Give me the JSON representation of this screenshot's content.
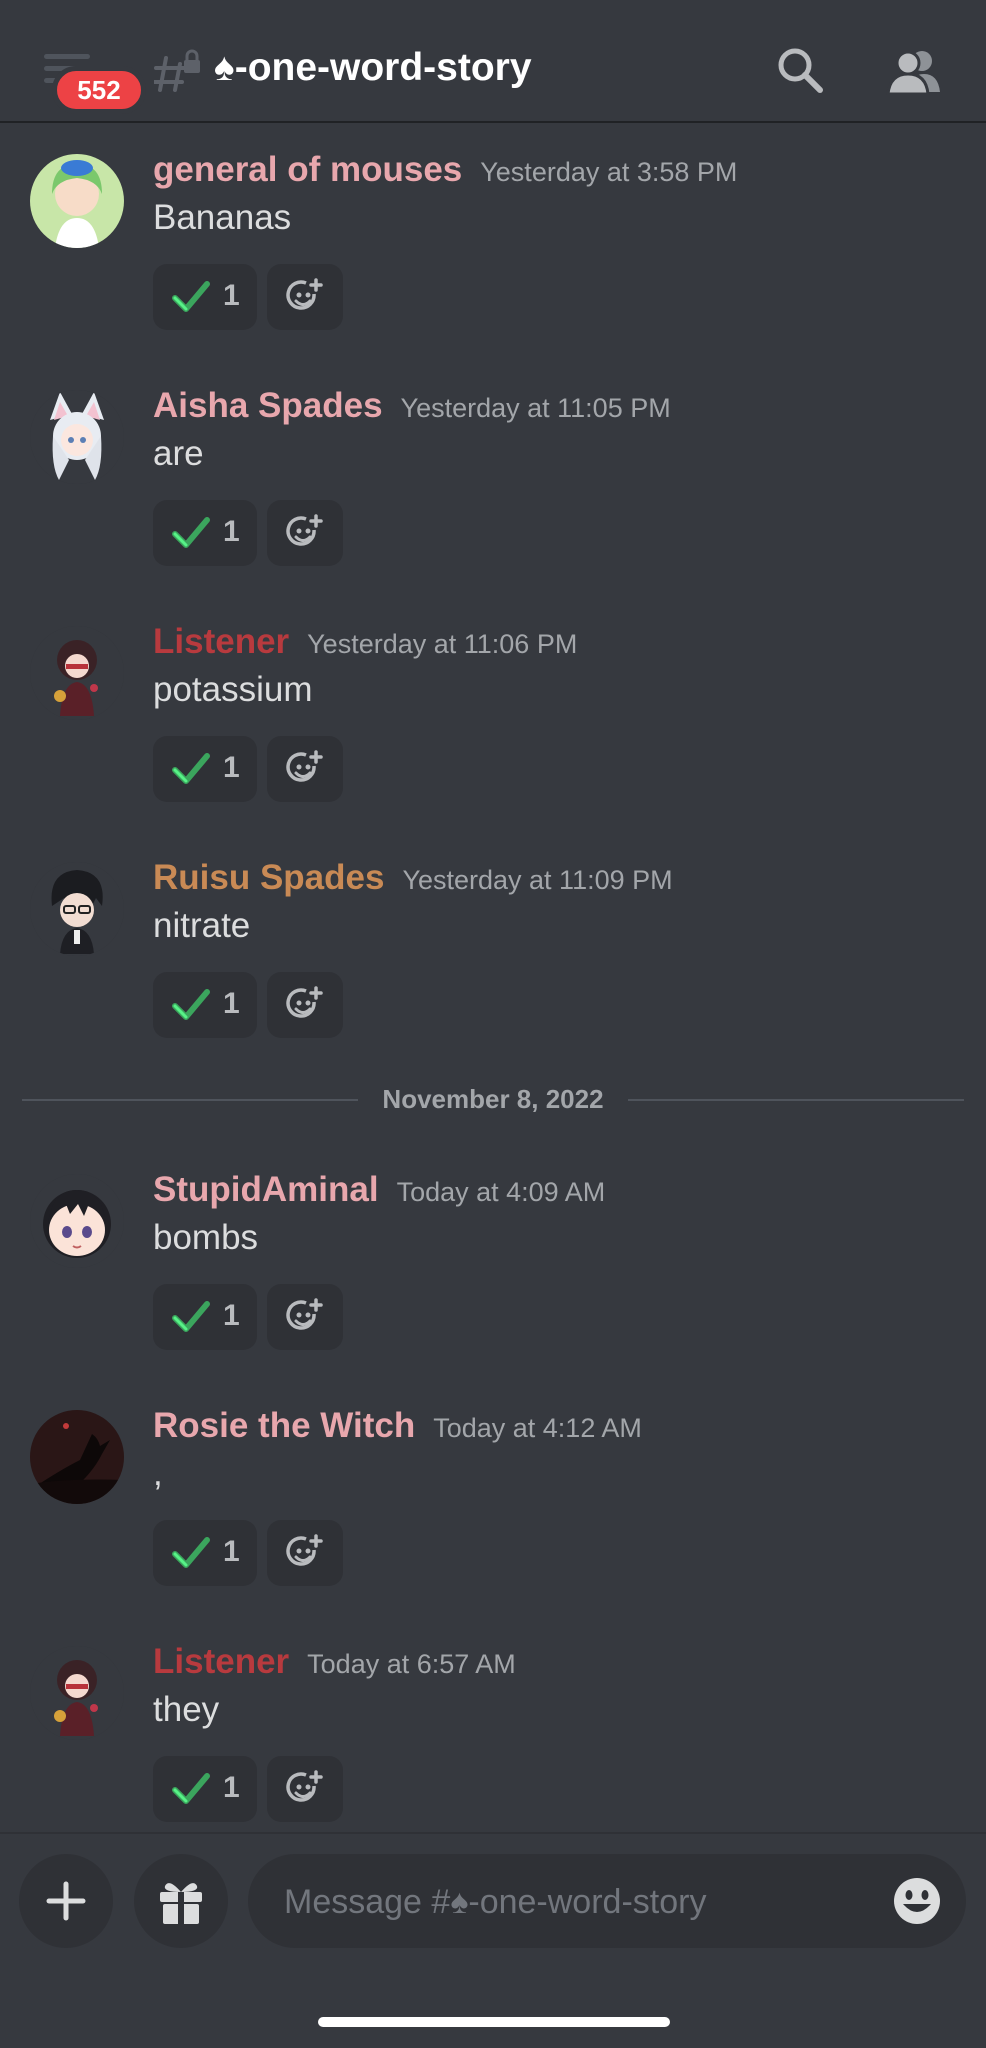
{
  "header": {
    "unread_badge": "552",
    "channel_name": "♠-one-word-story"
  },
  "messages": [
    {
      "username": "general of mouses",
      "username_color": "#e8a7ad",
      "timestamp": "Yesterday at 3:58 PM",
      "text": "Bananas",
      "reaction_count": "1"
    },
    {
      "username": "Aisha Spades",
      "username_color": "#e8a7ad",
      "timestamp": "Yesterday at 11:05 PM",
      "text": "are",
      "reaction_count": "1"
    },
    {
      "username": "Listener",
      "username_color": "#b83a3e",
      "timestamp": "Yesterday at 11:06 PM",
      "text": "potassium",
      "reaction_count": "1"
    },
    {
      "username": "Ruisu Spades",
      "username_color": "#c98a55",
      "timestamp": "Yesterday at 11:09 PM",
      "text": "nitrate",
      "reaction_count": "1"
    },
    {
      "username": "StupidAminal",
      "username_color": "#e8a7ad",
      "timestamp": "Today at 4:09 AM",
      "text": "bombs",
      "reaction_count": "1"
    },
    {
      "username": "Rosie the Witch",
      "username_color": "#e8a7ad",
      "timestamp": "Today at 4:12 AM",
      "text": ",",
      "reaction_count": "1"
    },
    {
      "username": "Listener",
      "username_color": "#b83a3e",
      "timestamp": "Today at 6:57 AM",
      "text": "they",
      "reaction_count": "1"
    }
  ],
  "divider": {
    "date": "November 8, 2022"
  },
  "composer": {
    "placeholder": "Message #♠-one-word-story"
  },
  "icons": {
    "menu": "hamburger-icon",
    "channel": "locked-thread-icon",
    "search": "search-icon",
    "members": "members-icon",
    "reaction": "check-mark-icon",
    "add_reaction": "add-reaction-icon",
    "plus": "plus-icon",
    "gift": "gift-icon",
    "emoji": "emoji-icon"
  }
}
